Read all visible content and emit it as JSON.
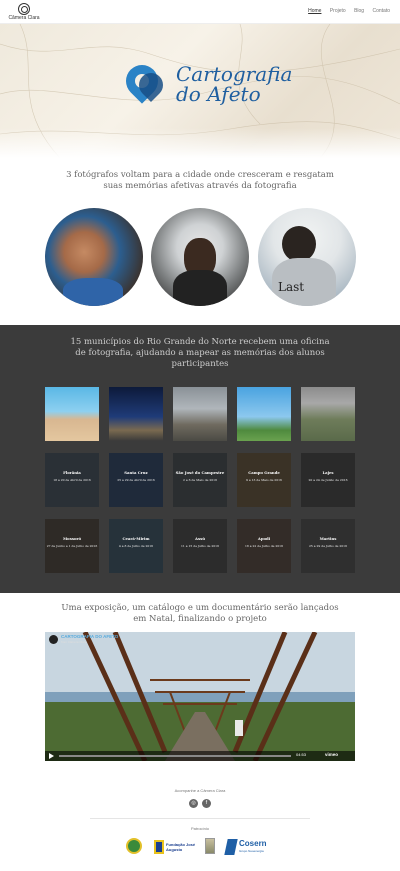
{
  "nav": {
    "logo_text": "Câmera Clara",
    "menu": [
      {
        "label": "Home",
        "active": true
      },
      {
        "label": "Projeto",
        "active": false
      },
      {
        "label": "Blog",
        "active": false
      },
      {
        "label": "Contato",
        "active": false
      }
    ]
  },
  "hero": {
    "brand_line1": "Cartografia",
    "brand_line2": "do Afeto"
  },
  "intro": {
    "text": "3 fotógrafos voltam para a cidade onde cresceram e resgatam suas memórias afetivas através da fotografia"
  },
  "photographers": [
    {
      "caption": ""
    },
    {
      "caption": ""
    },
    {
      "caption": "Last"
    }
  ],
  "workshops": {
    "text": "15 municípios do Rio Grande do Norte recebem uma oficina de fotografia, ajudando a mapear as memórias dos alunos participantes",
    "row2": [
      {
        "name": "Florânia",
        "dates": "18 a 20 de Abril de 2016"
      },
      {
        "name": "Santa Cruz",
        "dates": "25 a 29 de Abril de 2016"
      },
      {
        "name": "São José do Campestre",
        "dates": "2 a 6 de Maio de 2016"
      },
      {
        "name": "Campo Grande",
        "dates": "9 a 13 de Maio de 2016"
      },
      {
        "name": "Lajes",
        "dates": "20 a 24 de Junho de 2016"
      }
    ],
    "row3": [
      {
        "name": "Mossoró",
        "dates": "27 de Junho a 1 de Julho de 2016"
      },
      {
        "name": "Ceará-Mirim",
        "dates": "4 a 8 de Julho de 2016"
      },
      {
        "name": "Assú",
        "dates": "11 a 15 de Julho de 2016"
      },
      {
        "name": "Apodi",
        "dates": "18 a 22 de Julho de 2016"
      },
      {
        "name": "Martins",
        "dates": "25 a 29 de Julho de 2016"
      }
    ]
  },
  "launch": {
    "text": "Uma exposição, um catálogo e um documentário serão lançados em Natal, finalizando o projeto"
  },
  "video": {
    "title": "CARTOGRAFIA DO AFETO",
    "subtitle": "from Câmera Clara",
    "time": "04:53",
    "brand": "vimeo"
  },
  "footer": {
    "realization": "Acompanhe a Câmera Clara",
    "sponsors_label": "Patrocínio",
    "sponsors": [
      "Fundação José Augusto",
      "Cosern"
    ],
    "cosern_sub": "Grupo Neoenergia"
  },
  "colors": {
    "accent": "#2b83c6",
    "dark_band": "#3b3b3b"
  }
}
